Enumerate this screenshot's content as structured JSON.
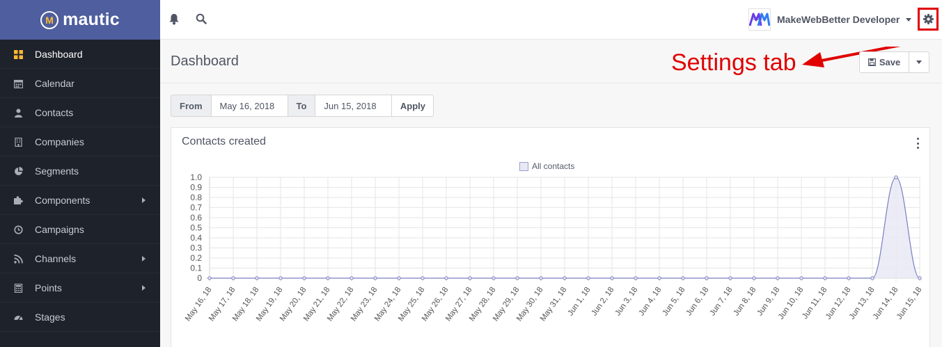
{
  "brand": {
    "name": "mautic",
    "mark": "M"
  },
  "sidebar": {
    "items": [
      {
        "label": "Dashboard",
        "icon": "dashboard-icon",
        "active": true,
        "submenu": false
      },
      {
        "label": "Calendar",
        "icon": "calendar-icon",
        "active": false,
        "submenu": false
      },
      {
        "label": "Contacts",
        "icon": "user-icon",
        "active": false,
        "submenu": false
      },
      {
        "label": "Companies",
        "icon": "building-icon",
        "active": false,
        "submenu": false
      },
      {
        "label": "Segments",
        "icon": "pie-chart-icon",
        "active": false,
        "submenu": false
      },
      {
        "label": "Components",
        "icon": "puzzle-icon",
        "active": false,
        "submenu": true
      },
      {
        "label": "Campaigns",
        "icon": "clock-icon",
        "active": false,
        "submenu": false
      },
      {
        "label": "Channels",
        "icon": "rss-icon",
        "active": false,
        "submenu": true
      },
      {
        "label": "Points",
        "icon": "calculator-icon",
        "active": false,
        "submenu": true
      },
      {
        "label": "Stages",
        "icon": "tachometer-icon",
        "active": false,
        "submenu": false
      }
    ]
  },
  "topbar": {
    "user_name": "MakeWebBetter Developer",
    "avatar_text": "MWB"
  },
  "header": {
    "title": "Dashboard",
    "annotation": "Settings tab",
    "save_label": "Save"
  },
  "filter": {
    "from_label": "From",
    "from_value": "May 16, 2018",
    "to_label": "To",
    "to_value": "Jun 15, 2018",
    "apply_label": "Apply"
  },
  "widget": {
    "title": "Contacts created"
  },
  "colors": {
    "brand": "#4e5e9e",
    "sidebar": "#1e222b",
    "accent": "#fdb933",
    "annotation": "#e00000",
    "series_line": "#7a7fbf",
    "series_fill": "#e8e9f4"
  },
  "chart_data": {
    "type": "line",
    "title": "",
    "xlabel": "",
    "ylabel": "",
    "ylim": [
      0,
      1
    ],
    "grid": true,
    "legend": "top-center",
    "x": [
      "May 16, 18",
      "May 17, 18",
      "May 18, 18",
      "May 19, 18",
      "May 20, 18",
      "May 21, 18",
      "May 22, 18",
      "May 23, 18",
      "May 24, 18",
      "May 25, 18",
      "May 26, 18",
      "May 27, 18",
      "May 28, 18",
      "May 29, 18",
      "May 30, 18",
      "May 31, 18",
      "Jun 1, 18",
      "Jun 2, 18",
      "Jun 3, 18",
      "Jun 4, 18",
      "Jun 5, 18",
      "Jun 6, 18",
      "Jun 7, 18",
      "Jun 8, 18",
      "Jun 9, 18",
      "Jun 10, 18",
      "Jun 11, 18",
      "Jun 12, 18",
      "Jun 13, 18",
      "Jun 14, 18",
      "Jun 15, 18"
    ],
    "y_ticks": [
      "0",
      "0.1",
      "0.2",
      "0.3",
      "0.4",
      "0.5",
      "0.6",
      "0.7",
      "0.8",
      "0.9",
      "1.0"
    ],
    "series": [
      {
        "name": "All contacts",
        "values": [
          0,
          0,
          0,
          0,
          0,
          0,
          0,
          0,
          0,
          0,
          0,
          0,
          0,
          0,
          0,
          0,
          0,
          0,
          0,
          0,
          0,
          0,
          0,
          0,
          0,
          0,
          0,
          0,
          0,
          1,
          0
        ]
      }
    ]
  }
}
